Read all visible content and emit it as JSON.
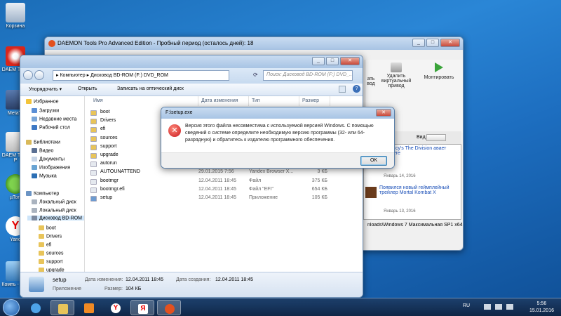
{
  "desktop": {
    "icons": [
      {
        "label": "Корзина"
      },
      {
        "label": "DAEM Tools"
      },
      {
        "label": "MetaTr"
      },
      {
        "label": "DAEM Tools P"
      },
      {
        "label": "µTorr"
      },
      {
        "label": "Yand"
      },
      {
        "label": "Компь - Ярл"
      }
    ]
  },
  "daemon": {
    "title": "DAEMON Tools Pro Advanced Edition - Пробный период (осталось дней): 18",
    "toolbar": {
      "remove_drive": "Удалить виртуальный привод",
      "mount": "Монтировать",
      "partial_left": "ать вод"
    },
    "view_label": "Вид",
    "news": [
      {
        "title": "ку Том cy's The Division авает о сюжете",
        "date": "Январь 14, 2016"
      },
      {
        "title": "Появился новый геймплейный трейлер Mortal Kombat X",
        "date": "Январь 13, 2016"
      }
    ],
    "path": "nloads\\Windows 7 Максимальная SP1 x64 by"
  },
  "explorer": {
    "address": {
      "part1": "Компьютер",
      "part2": "Дисковод BD-ROM (F:) DVD_ROM"
    },
    "search_placeholder": "Поиск: Дисковод BD-ROM (F:) DVD_...",
    "commands": {
      "organize": "Упорядочить ▾",
      "open": "Открыть",
      "burn": "Записать на оптический диск"
    },
    "nav": {
      "favorites": "Избранное",
      "downloads": "Загрузки",
      "recent": "Недавние места",
      "desktop": "Рабочий стол",
      "libraries": "Библиотеки",
      "video": "Видео",
      "documents": "Документы",
      "images": "Изображения",
      "music": "Музыка",
      "computer": "Компьютер",
      "local1": "Локальный диск",
      "local2": "Локальный диск",
      "dvd": "Дисковод BD-ROM",
      "sub_boot": "boot",
      "sub_drivers": "Drivers",
      "sub_efi": "efi",
      "sub_sources": "sources",
      "sub_support": "support",
      "sub_upgrade": "upgrade"
    },
    "columns": {
      "name": "Имя",
      "date": "Дата изменения",
      "type": "Тип",
      "size": "Размер"
    },
    "files": [
      {
        "name": "boot",
        "date": "",
        "type": "",
        "size": "",
        "kind": "folder"
      },
      {
        "name": "Drivers",
        "date": "",
        "type": "",
        "size": "",
        "kind": "folder"
      },
      {
        "name": "efi",
        "date": "",
        "type": "",
        "size": "",
        "kind": "folder"
      },
      {
        "name": "sources",
        "date": "",
        "type": "",
        "size": "",
        "kind": "folder"
      },
      {
        "name": "support",
        "date": "",
        "type": "",
        "size": "",
        "kind": "folder"
      },
      {
        "name": "upgrade",
        "date": "",
        "type": "",
        "size": "",
        "kind": "folder"
      },
      {
        "name": "autorun",
        "date": "",
        "type": "",
        "size": "",
        "kind": "file"
      },
      {
        "name": "AUTOUNATTEND",
        "date": "29.01.2015 7:56",
        "type": "Yandex Browser X...",
        "size": "3 КБ",
        "kind": "file"
      },
      {
        "name": "bootmgr",
        "date": "12.04.2011 18:45",
        "type": "Файл",
        "size": "375 КБ",
        "kind": "file"
      },
      {
        "name": "bootmgr.efi",
        "date": "12.04.2011 18:45",
        "type": "Файл \"EFI\"",
        "size": "654 КБ",
        "kind": "file"
      },
      {
        "name": "setup",
        "date": "12.04.2011 18:45",
        "type": "Приложение",
        "size": "105 КБ",
        "kind": "app"
      }
    ],
    "details": {
      "name": "setup",
      "kind": "Приложение",
      "modified_label": "Дата изменения:",
      "modified": "12.04.2011 18:45",
      "created_label": "Дата создания:",
      "created": "12.04.2011 18:45",
      "size_label": "Размер:",
      "size": "104 КБ"
    }
  },
  "dialog": {
    "title": "F:\\setup.exe",
    "message": "Версия этого файла несовместима с используемой версией Windows. С помощью сведений о системе определите необходимую версию программы (32- или 64-разрядную) и обратитесь к издателю программного обеспечения.",
    "ok": "OK"
  },
  "taskbar": {
    "lang": "RU",
    "time": "5:56",
    "date": "15.01.2016"
  },
  "colors": {
    "folder": "#e8c45a",
    "error": "#c8161d",
    "link": "#1a4fb8"
  }
}
